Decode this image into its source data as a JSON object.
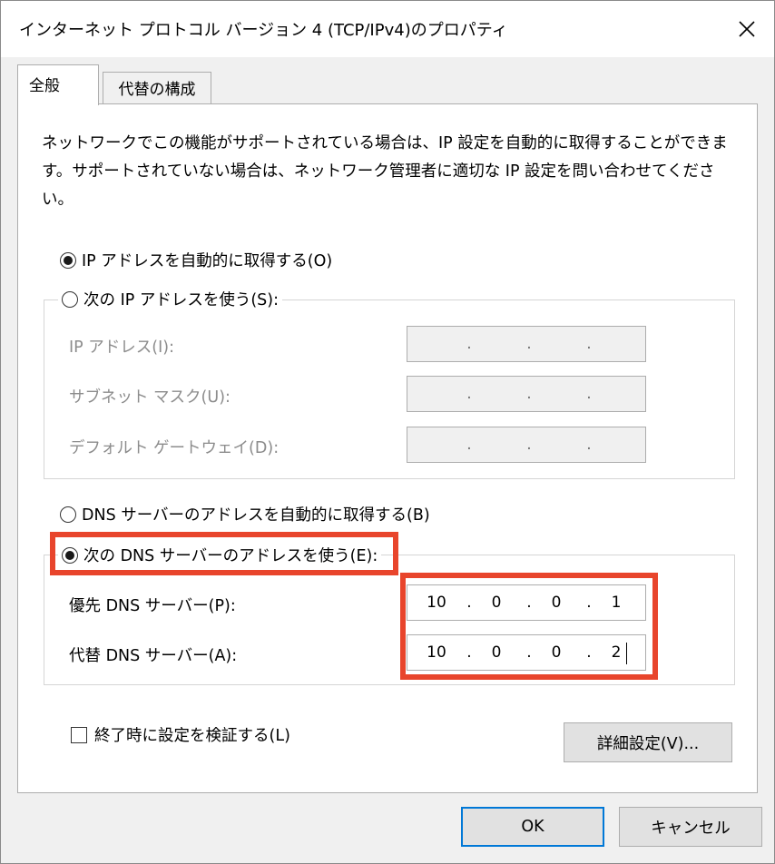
{
  "window": {
    "title": "インターネット プロトコル バージョン 4 (TCP/IPv4)のプロパティ"
  },
  "tabs": [
    {
      "label": "全般",
      "active": true
    },
    {
      "label": "代替の構成",
      "active": false
    }
  ],
  "description": "ネットワークでこの機能がサポートされている場合は、IP 設定を自動的に取得することができます。サポートされていない場合は、ネットワーク管理者に適切な IP 設定を問い合わせてください。",
  "ip": {
    "auto_label": "IP アドレスを自動的に取得する(O)",
    "auto_selected": true,
    "manual_label": "次の IP アドレスを使う(S):",
    "manual_selected": false,
    "fields": [
      {
        "label": "IP アドレス(I):",
        "value": [
          "",
          "",
          "",
          ""
        ]
      },
      {
        "label": "サブネット マスク(U):",
        "value": [
          "",
          "",
          "",
          ""
        ]
      },
      {
        "label": "デフォルト ゲートウェイ(D):",
        "value": [
          "",
          "",
          "",
          ""
        ]
      }
    ]
  },
  "dns": {
    "auto_label": "DNS サーバーのアドレスを自動的に取得する(B)",
    "auto_selected": false,
    "manual_label": "次の DNS サーバーのアドレスを使う(E):",
    "manual_selected": true,
    "preferred": {
      "label": "優先 DNS サーバー(P):",
      "octets": [
        "10",
        "0",
        "0",
        "1"
      ]
    },
    "alternate": {
      "label": "代替 DNS サーバー(A):",
      "octets": [
        "10",
        "0",
        "0",
        "2"
      ]
    }
  },
  "validate_label": "終了時に設定を検証する(L)",
  "advanced_label": "詳細設定(V)...",
  "ok_label": "OK",
  "cancel_label": "キャンセル",
  "colors": {
    "highlight": "#e8452c",
    "default_button_border": "#0078d7"
  },
  "icons": {
    "close": "close-icon"
  }
}
